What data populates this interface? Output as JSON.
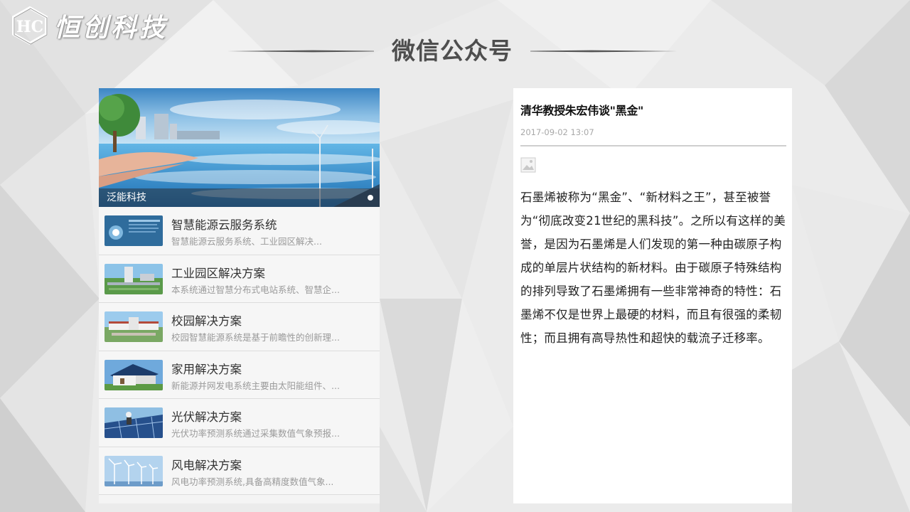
{
  "logo": {
    "mark": "HC",
    "text": "恒创科技"
  },
  "page": {
    "title": "微信公众号"
  },
  "banner": {
    "caption": "泛能科技"
  },
  "list": {
    "items": [
      {
        "title": "智慧能源云服务系统",
        "desc": "智慧能源云服务系统、工业园区解决...",
        "icon": "dashboard-thumbnail"
      },
      {
        "title": "工业园区解决方案",
        "desc": "本系统通过智慧分布式电站系统、智慧企...",
        "icon": "industrial-park-thumbnail"
      },
      {
        "title": "校园解决方案",
        "desc": "校园智慧能源系统是基于前瞻性的创新理...",
        "icon": "campus-thumbnail"
      },
      {
        "title": "家用解决方案",
        "desc": "新能源并网发电系统主要由太阳能组件、...",
        "icon": "house-solar-thumbnail"
      },
      {
        "title": "光伏解决方案",
        "desc": "光伏功率预测系统通过采集数值气象预报...",
        "icon": "solar-panel-thumbnail"
      },
      {
        "title": "风电解决方案",
        "desc": "风电功率预测系统,具备高精度数值气象...",
        "icon": "wind-turbine-thumbnail"
      }
    ]
  },
  "article": {
    "title": "清华教授朱宏伟谈\"黑金\"",
    "date": "2017-09-02 13:07",
    "body": "石墨烯被称为“黑金”、“新材料之王”，甚至被誉为“彻底改变21世纪的黑科技”。之所以有这样的美誉，是因为石墨烯是人们发现的第一种由碳原子构成的单层片状结构的新材料。由于碳原子特殊结构的排列导致了石墨烯拥有一些非常神奇的特性：石墨烯不仅是世界上最硬的材料，而且有很强的柔韧性；而且拥有高导热性和超快的载流子迁移率。"
  }
}
